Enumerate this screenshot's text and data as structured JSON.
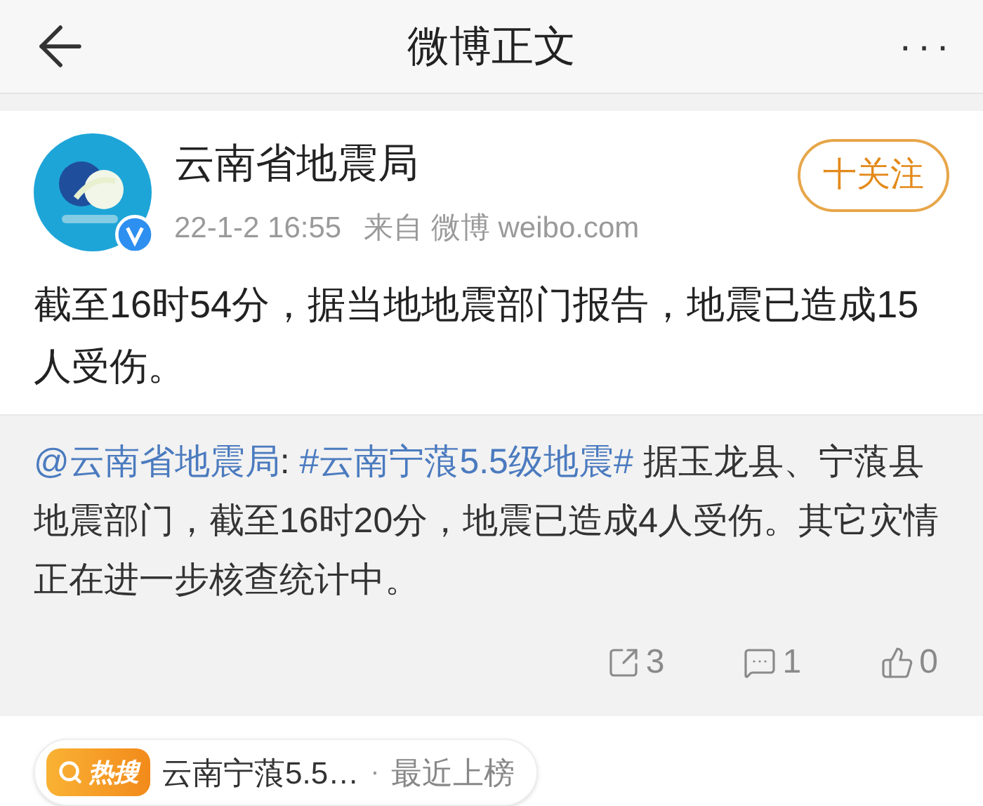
{
  "header": {
    "title": "微博正文",
    "more": "···"
  },
  "post": {
    "author": "云南省地震局",
    "verified": true,
    "followed": false,
    "follow_label": "十关注",
    "time": "22-1-2 16:55",
    "source": "来自 微博 weibo.com",
    "text": "截至16时54分，据当地地震部门报告，地震已造成15人受伤。"
  },
  "repost": {
    "parts": [
      {
        "kind": "mention",
        "text": "@云南省地震局"
      },
      {
        "kind": "text",
        "text": ": "
      },
      {
        "kind": "topic",
        "text": "#云南宁蒗5.5级地震#"
      },
      {
        "kind": "text",
        "text": " 据玉龙县、宁蒗县地震部门，截至16时20分，地震已造成4人受伤。其它灾情正在进一步核查统计中。"
      }
    ],
    "actions": [
      {
        "kind": "repost",
        "count": "3"
      },
      {
        "kind": "comment",
        "count": "1"
      },
      {
        "kind": "like",
        "count": "0"
      }
    ]
  },
  "hot_search": {
    "badge": "热搜",
    "topic": "云南宁蒗5.5…",
    "separator": "·",
    "status": "最近上榜"
  }
}
